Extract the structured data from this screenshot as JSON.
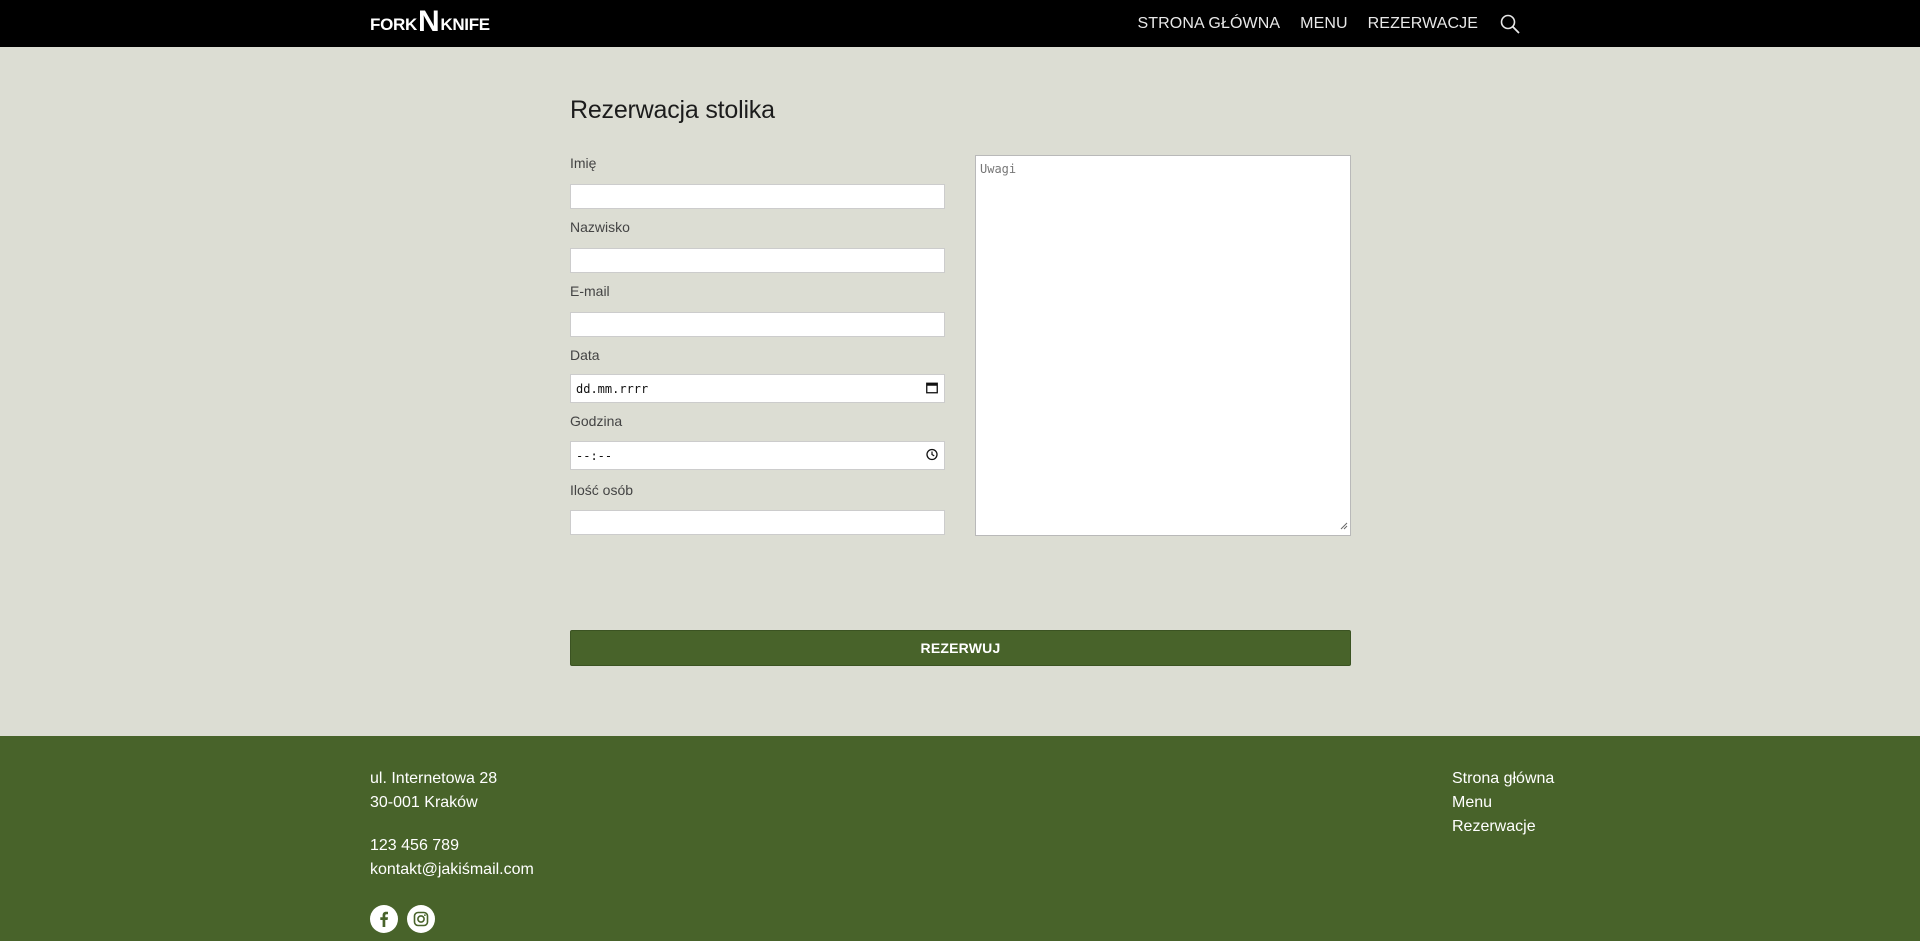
{
  "header": {
    "logo": {
      "left": "FORK",
      "mid": "N",
      "right": "KNIFE"
    },
    "nav": [
      "STRONA GŁÓWNA",
      "MENU",
      "REZERWACJE"
    ],
    "search_icon": "search-icon"
  },
  "form": {
    "title": "Rezerwacja stolika",
    "fields": {
      "first_name": {
        "label": "Imię",
        "value": ""
      },
      "last_name": {
        "label": "Nazwisko",
        "value": ""
      },
      "email": {
        "label": "E-mail",
        "value": ""
      },
      "date": {
        "label": "Data",
        "placeholder": "dd.mm.rrrr",
        "icon": "calendar-icon"
      },
      "time": {
        "label": "Godzina",
        "placeholder": "--:--",
        "icon": "clock-icon"
      },
      "people": {
        "label": "Ilość osób",
        "value": ""
      }
    },
    "notes_placeholder": "Uwagi",
    "submit_label": "REZERWUJ"
  },
  "footer": {
    "address_line1": "ul. Internetowa 28",
    "address_line2": "30-001 Kraków",
    "phone": "123 456 789",
    "email": "kontakt@jakiśmail.com",
    "links": [
      "Strona główna",
      "Menu",
      "Rezerwacje"
    ],
    "socials": [
      "facebook-icon",
      "instagram-icon"
    ],
    "accent": "#48632a"
  }
}
